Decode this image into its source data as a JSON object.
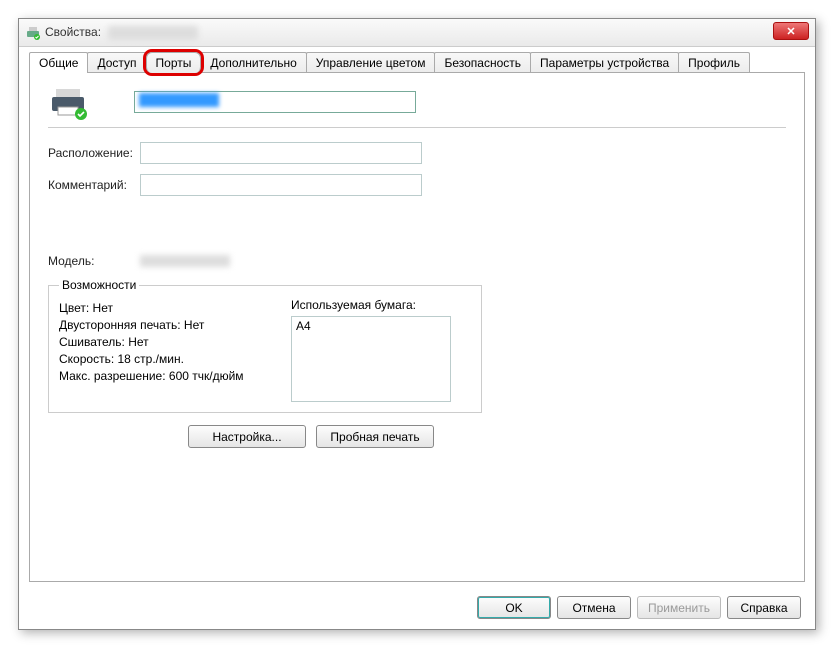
{
  "window": {
    "title_prefix": "Свойства:",
    "close_symbol": "✕"
  },
  "tabs": {
    "general": "Общие",
    "sharing": "Доступ",
    "ports": "Порты",
    "advanced": "Дополнительно",
    "color": "Управление цветом",
    "security": "Безопасность",
    "device": "Параметры устройства",
    "profile": "Профиль"
  },
  "general": {
    "location_label": "Расположение:",
    "comment_label": "Комментарий:",
    "model_label": "Модель:",
    "location_value": "",
    "comment_value": ""
  },
  "capabilities": {
    "legend": "Возможности",
    "color": "Цвет: Нет",
    "duplex": "Двусторонняя печать: Нет",
    "stapler": "Сшиватель: Нет",
    "speed": "Скорость: 18 стр./мин.",
    "resolution": "Макс. разрешение: 600 тчк/дюйм",
    "paper_label": "Используемая бумага:",
    "paper_item": "A4"
  },
  "buttons": {
    "settings": "Настройка...",
    "test": "Пробная печать",
    "ok": "OK",
    "cancel": "Отмена",
    "apply": "Применить",
    "help": "Справка"
  }
}
